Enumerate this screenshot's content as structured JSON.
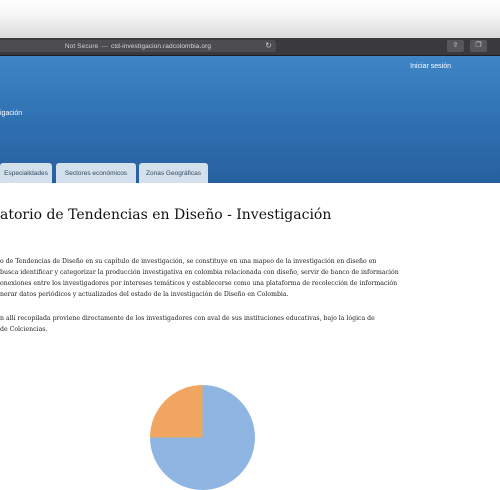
{
  "browser": {
    "url_security": "Not Secure",
    "url_separator": "—",
    "url_domain": "ctd-investigacion.radcolombia.org",
    "reload_icon": "reload-icon",
    "share_icon": "share-icon",
    "tabs_icon": "tabs-icon"
  },
  "header": {
    "login_label": "Iniciar sesión",
    "brand_text": "igación"
  },
  "nav": {
    "tabs": [
      {
        "label": "Especialidades"
      },
      {
        "label": "Sectores económicos"
      },
      {
        "label": "Zonas Geográficas"
      }
    ]
  },
  "main": {
    "title": "atorio de Tendencias en Diseño - Investigación",
    "paragraph1": [
      "o de Tendencias de Diseño en su capítulo de investigación, se constituye en una mapeo de la investigación en diseño en",
      "busca identificar y categorizar la producción investigativa en colombia relacionada con diseño, servir de banco de información",
      "onexiones entre los investigadores por intereses temáticos y establecerse como una plataforma de recolección de información",
      "nerar datos periódicos y actualizados del estado de la investigación de Diseño en Colombia."
    ],
    "paragraph2": [
      "n allí recopilada proviene directamente de los investigadores con aval de sus instituciones educativas, bajo la lógica de",
      "de Colciencias."
    ]
  },
  "colors": {
    "header_blue": "#2f72b3",
    "tab_bg": "#d4e0ec",
    "pie_orange": "#f0a660",
    "pie_blue": "#8fb5e2"
  }
}
